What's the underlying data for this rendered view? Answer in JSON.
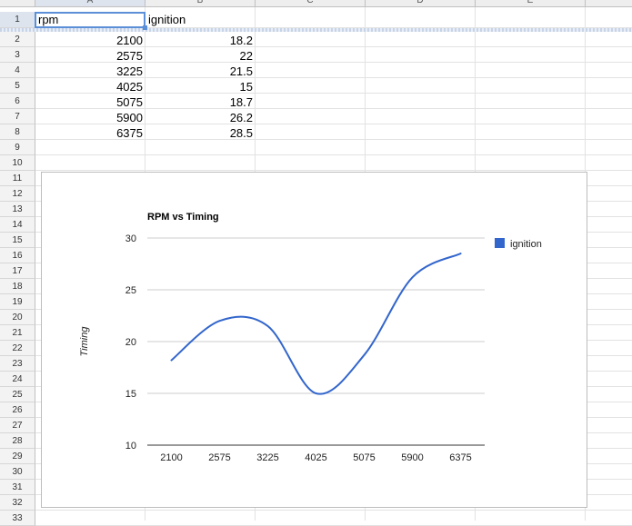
{
  "columns": [
    "A",
    "B",
    "C",
    "D",
    "E"
  ],
  "rows": [
    "1",
    "2",
    "3",
    "4",
    "5",
    "6",
    "7",
    "8",
    "9",
    "10",
    "11",
    "12",
    "13",
    "14",
    "15",
    "16",
    "17",
    "18",
    "19",
    "20",
    "21",
    "22",
    "23",
    "24",
    "25",
    "26",
    "27",
    "28",
    "29",
    "30",
    "31",
    "32",
    "33"
  ],
  "cells": {
    "header": [
      "rpm",
      "ignition"
    ],
    "data": [
      [
        "2100",
        "18.2"
      ],
      [
        "2575",
        "22"
      ],
      [
        "3225",
        "21.5"
      ],
      [
        "4025",
        "15"
      ],
      [
        "5075",
        "18.7"
      ],
      [
        "5900",
        "26.2"
      ],
      [
        "6375",
        "28.5"
      ]
    ]
  },
  "colors": {
    "series": "#3366cc",
    "selection": "#5b8fd8"
  },
  "chart_data": {
    "type": "line",
    "title": "RPM vs Timing",
    "xlabel": "",
    "ylabel": "Timing",
    "categories": [
      "2100",
      "2575",
      "3225",
      "4025",
      "5075",
      "5900",
      "6375"
    ],
    "series": [
      {
        "name": "ignition",
        "values": [
          18.2,
          22,
          21.5,
          15,
          18.7,
          26.2,
          28.5
        ]
      }
    ],
    "yticks": [
      "10",
      "15",
      "20",
      "25",
      "30"
    ],
    "ylim": [
      10,
      30
    ],
    "smooth": true,
    "grid": true,
    "legend": "right"
  }
}
